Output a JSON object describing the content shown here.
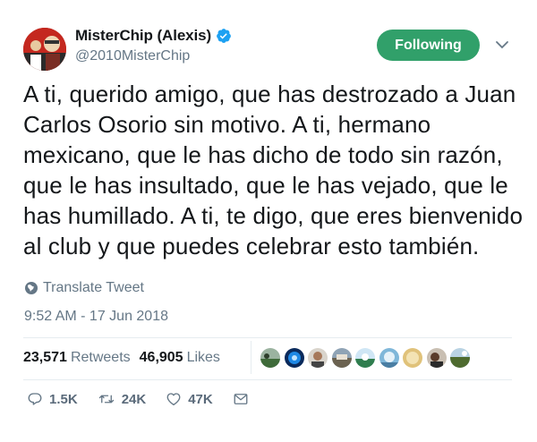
{
  "user": {
    "display_name": "MisterChip (Alexis)",
    "handle": "@2010MisterChip",
    "verified": true
  },
  "follow_button": {
    "label": "Following",
    "color": "#31a06a"
  },
  "tweet": {
    "text": "A ti, querido amigo, que has destrozado a Juan Carlos Osorio sin motivo. A ti, hermano mexicano, que le has dicho de todo sin razón, que le has insultado, que le has vejado, que le has humillado. A ti, te digo, que eres bienvenido al club y que puedes celebrar esto también.",
    "translate_label": "Translate Tweet",
    "timestamp": "9:52 AM - 17 Jun 2018"
  },
  "stats": {
    "retweets_count": "23,571",
    "retweets_label": "Retweets",
    "likes_count": "46,905",
    "likes_label": "Likes"
  },
  "actions": {
    "replies": "1.5K",
    "retweets": "24K",
    "likes": "47K"
  },
  "icons": {
    "verified": "verified-badge-icon",
    "caret": "chevron-down-icon",
    "translate": "globe-icon",
    "reply": "reply-icon",
    "retweet": "retweet-icon",
    "like": "heart-icon",
    "message": "envelope-icon"
  },
  "colors": {
    "accent": "#1da1f2",
    "muted": "#657786",
    "follow": "#31a06a"
  }
}
